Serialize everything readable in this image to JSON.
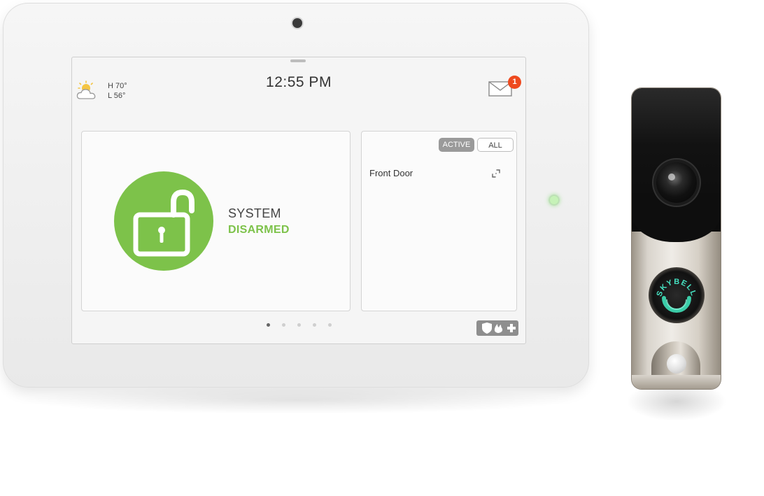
{
  "status_bar": {
    "weather": {
      "icon": "partly-cloudy-icon",
      "high": "H 70°",
      "low": "L 56°"
    },
    "time": "12:55 PM",
    "messages": {
      "icon": "envelope-icon",
      "unread_count": "1"
    }
  },
  "security_card": {
    "icon": "unlocked-padlock-icon",
    "line1": "SYSTEM",
    "line2": "DISARMED",
    "status_color": "#7dc24a"
  },
  "sensors_card": {
    "filters": [
      {
        "label": "ACTIVE",
        "selected": true
      },
      {
        "label": "ALL",
        "selected": false
      }
    ],
    "sensors": [
      {
        "name": "Front Door",
        "icon": "door-open-icon"
      }
    ]
  },
  "pager": {
    "pages": 5,
    "current": 1
  },
  "emergency_button": {
    "icons": [
      "shield-icon",
      "fire-icon",
      "medical-cross-icon"
    ]
  },
  "doorbell": {
    "brand_text": "SKYBELL"
  },
  "colors": {
    "accent_green": "#7dc24a",
    "badge_red": "#ee4a1f"
  }
}
